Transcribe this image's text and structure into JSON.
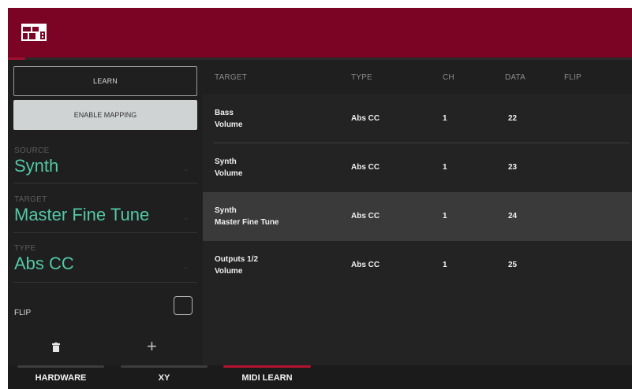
{
  "header": {
    "icon": "grid-layout-icon"
  },
  "left_panel": {
    "learn_label": "LEARN",
    "enable_mapping_label": "ENABLE MAPPING",
    "source": {
      "label": "SOURCE",
      "value": "Synth"
    },
    "target": {
      "label": "TARGET",
      "value": "Master Fine Tune"
    },
    "type": {
      "label": "TYPE",
      "value": "Abs CC"
    },
    "flip": {
      "label": "FLIP",
      "checked": false
    },
    "delete_icon": "trash-icon",
    "add_icon": "plus-icon"
  },
  "table": {
    "columns": [
      "TARGET",
      "TYPE",
      "CH",
      "DATA",
      "FLIP"
    ],
    "rows": [
      {
        "target_line1": "Bass",
        "target_line2": "Volume",
        "type": "Abs CC",
        "ch": "1",
        "data": "22",
        "flip": ""
      },
      {
        "target_line1": "Synth",
        "target_line2": "Volume",
        "type": "Abs CC",
        "ch": "1",
        "data": "23",
        "flip": ""
      },
      {
        "target_line1": "Synth",
        "target_line2": "Master Fine Tune",
        "type": "Abs CC",
        "ch": "1",
        "data": "24",
        "flip": "",
        "selected": true
      },
      {
        "target_line1": "Outputs 1/2",
        "target_line2": "Volume",
        "type": "Abs CC",
        "ch": "1",
        "data": "25",
        "flip": ""
      }
    ]
  },
  "tabs": [
    {
      "label": "HARDWARE",
      "active": false
    },
    {
      "label": "XY",
      "active": false
    },
    {
      "label": "MIDI LEARN",
      "active": true
    }
  ],
  "colors": {
    "header": "#7b0424",
    "accent": "#b4122f",
    "value_green": "#53c8a6"
  }
}
